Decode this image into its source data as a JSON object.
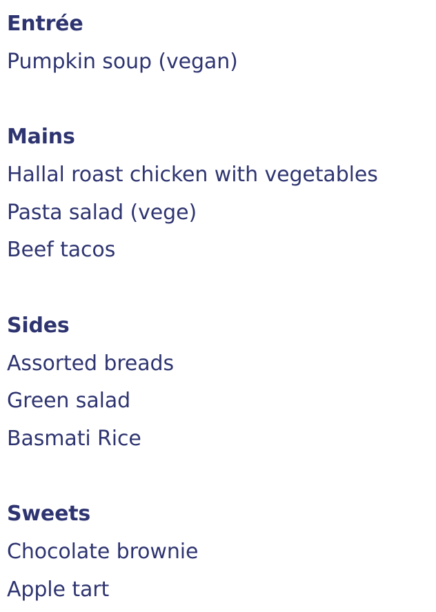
{
  "menu": {
    "sections": [
      {
        "title": "Entrée",
        "items": [
          "Pumpkin soup (vegan)"
        ]
      },
      {
        "title": "Mains",
        "items": [
          "Hallal roast chicken with vegetables",
          "Pasta salad (vege)",
          "Beef tacos"
        ]
      },
      {
        "title": "Sides",
        "items": [
          "Assorted breads",
          "Green salad",
          "Basmati Rice"
        ]
      },
      {
        "title": "Sweets",
        "items": [
          "Chocolate brownie",
          "Apple tart"
        ]
      }
    ]
  },
  "colors": {
    "text": "#2e3470",
    "background": "#ffffff"
  }
}
